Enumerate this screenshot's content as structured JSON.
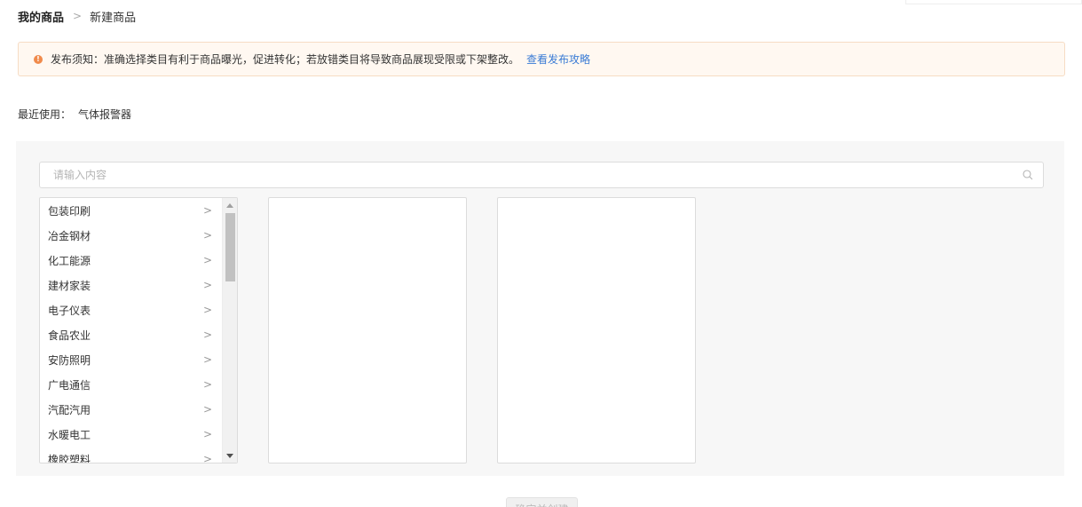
{
  "breadcrumb": {
    "root": "我的商品",
    "separator": ">",
    "current": "新建商品"
  },
  "notice": {
    "icon": "exclamation-circle-icon",
    "text": "发布须知：准确选择类目有利于商品曝光，促进转化；若放错类目将导致商品展现受限或下架整改。",
    "link": "查看发布攻略",
    "accent_color": "#f08a4b",
    "link_color": "#3a7bd5"
  },
  "recent": {
    "label": "最近使用：",
    "item": "气体报警器"
  },
  "search": {
    "placeholder": "请输入内容",
    "icon": "search-icon"
  },
  "categories": {
    "level1": [
      {
        "label": "包装印刷",
        "arrow": ">"
      },
      {
        "label": "冶金钢材",
        "arrow": ">"
      },
      {
        "label": "化工能源",
        "arrow": ">"
      },
      {
        "label": "建材家装",
        "arrow": ">"
      },
      {
        "label": "电子仪表",
        "arrow": ">"
      },
      {
        "label": "食品农业",
        "arrow": ">"
      },
      {
        "label": "安防照明",
        "arrow": ">"
      },
      {
        "label": "广电通信",
        "arrow": ">"
      },
      {
        "label": "汽配汽用",
        "arrow": ">"
      },
      {
        "label": "水暖电工",
        "arrow": ">"
      },
      {
        "label": "橡胶塑料",
        "arrow": ">"
      }
    ],
    "level2": [],
    "level3": []
  },
  "actions": {
    "next_label": "确定并创建"
  }
}
